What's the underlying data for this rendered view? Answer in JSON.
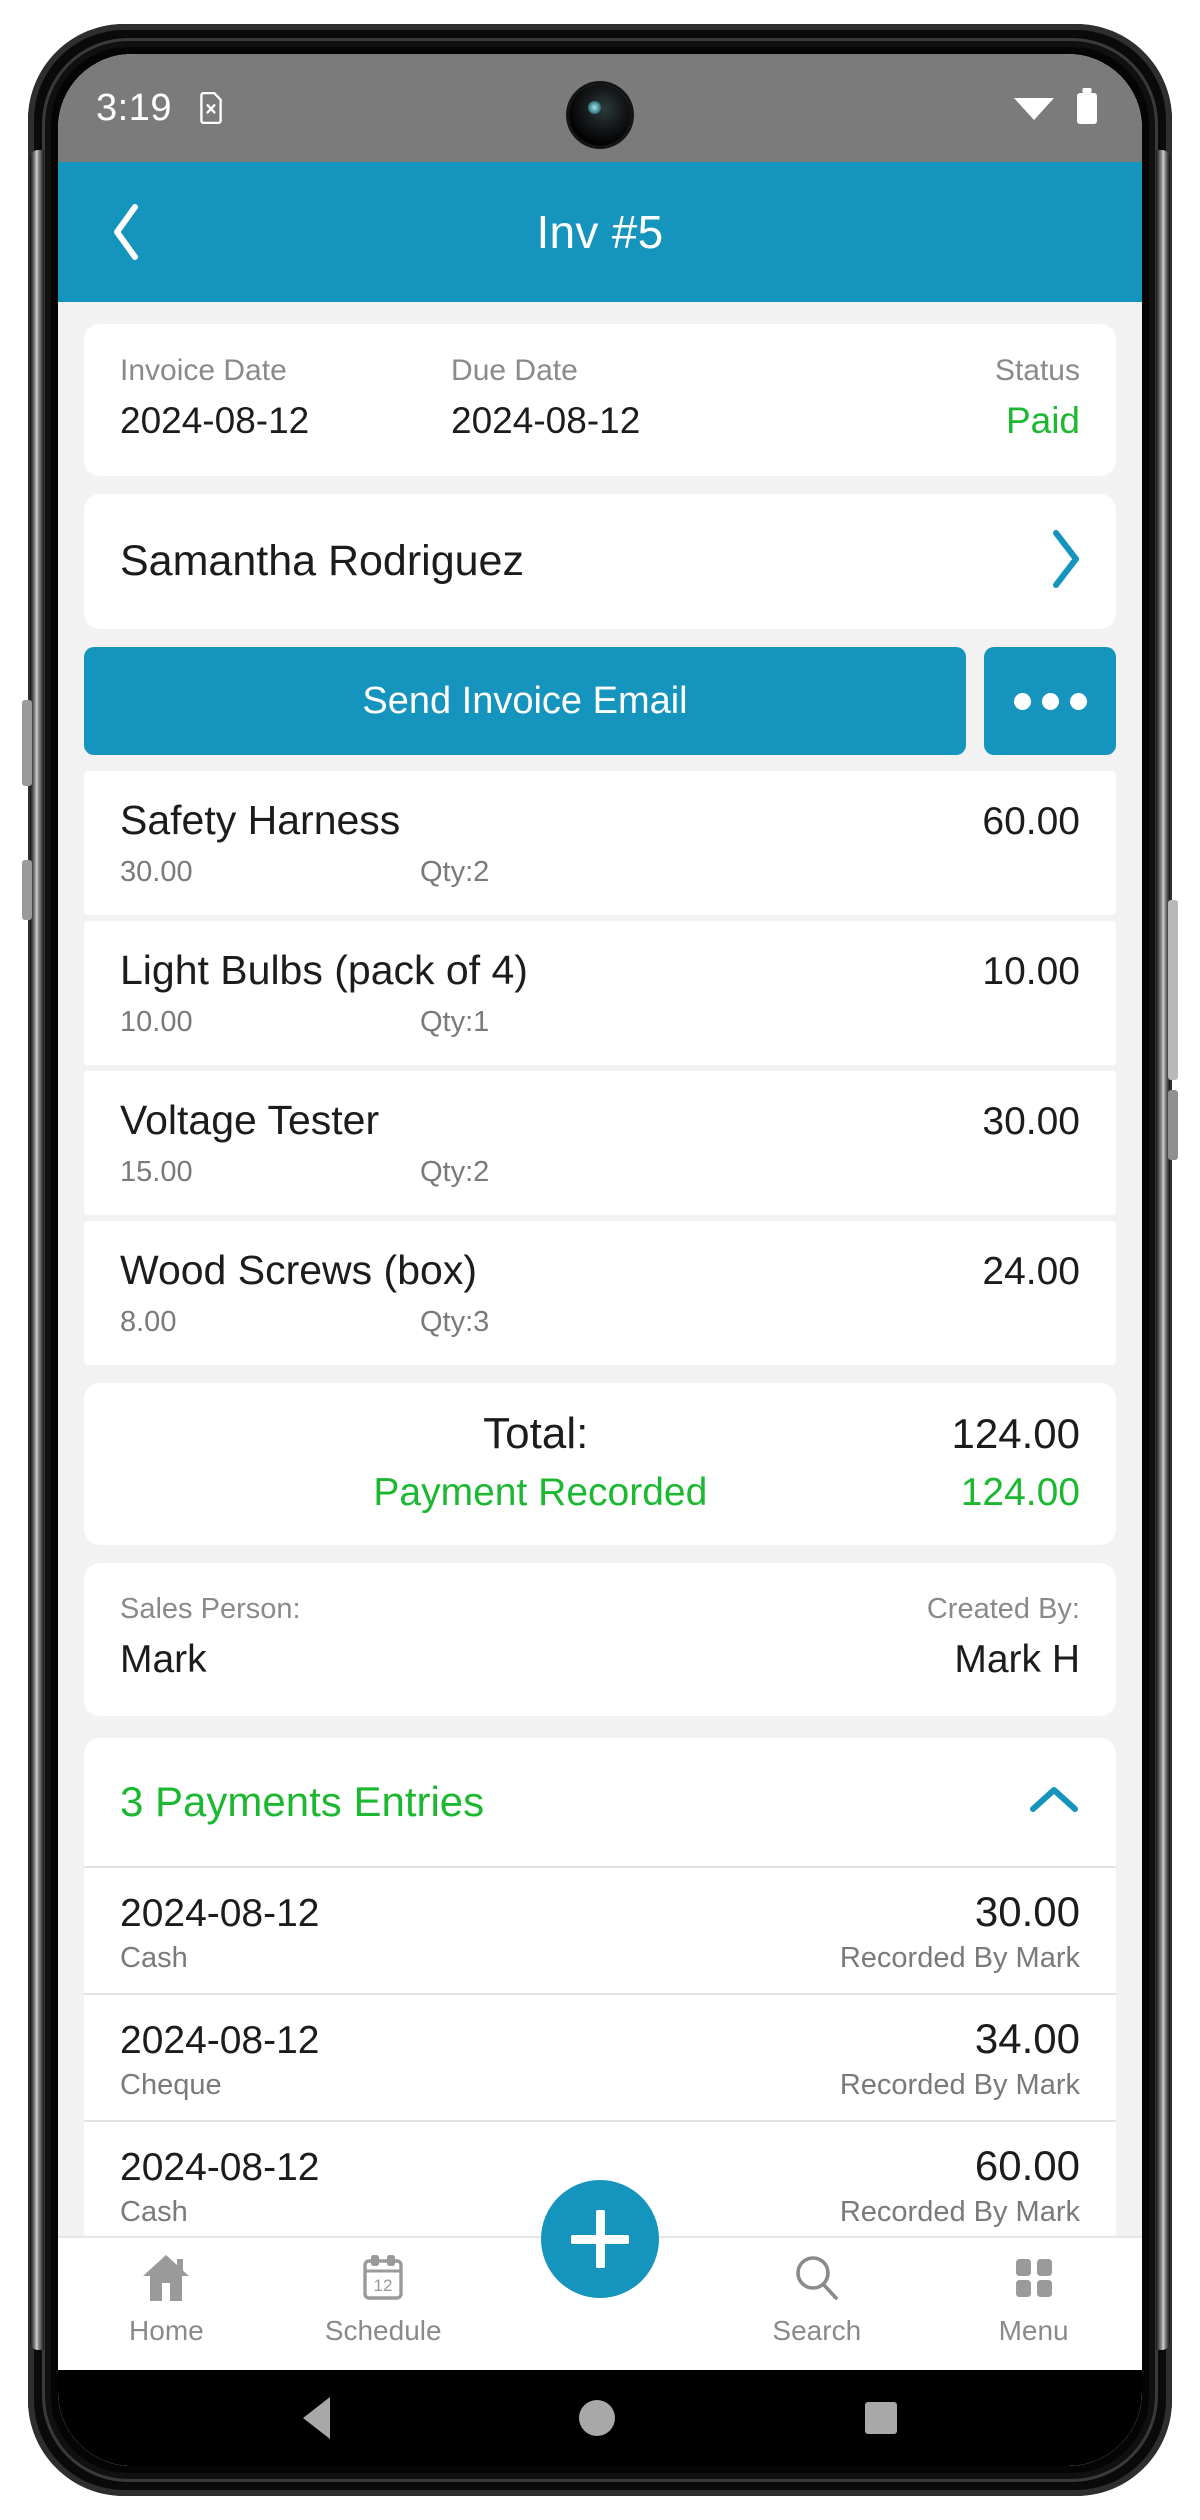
{
  "colors": {
    "accent": "#1594be",
    "success": "#1db832",
    "statusbar": "#7b7b7b",
    "page_bg": "#f2f2f2",
    "card_bg": "#ffffff",
    "muted_text": "#8a8a8a",
    "primary_text": "#1c1c1c"
  },
  "statusbar": {
    "time": "3:19",
    "sim_icon": "sim-card-off-icon",
    "wifi_icon": "wifi-icon",
    "battery_icon": "battery-icon"
  },
  "appbar": {
    "back_icon": "chevron-left-icon",
    "title": "Inv #5"
  },
  "dates": {
    "invoice_date_label": "Invoice Date",
    "invoice_date_value": "2024-08-12",
    "due_date_label": "Due Date",
    "due_date_value": "2024-08-12",
    "status_label": "Status",
    "status_value": "Paid"
  },
  "customer": {
    "name": "Samantha Rodriguez",
    "chevron_icon": "chevron-right-icon"
  },
  "actions": {
    "send_email_label": "Send Invoice Email",
    "more_icon": "ellipsis-icon"
  },
  "line_items": [
    {
      "name": "Safety Harness",
      "amount": "60.00",
      "unit_price": "30.00",
      "qty": "Qty:2"
    },
    {
      "name": "Light Bulbs (pack of 4)",
      "amount": "10.00",
      "unit_price": "10.00",
      "qty": "Qty:1"
    },
    {
      "name": "Voltage Tester",
      "amount": "30.00",
      "unit_price": "15.00",
      "qty": "Qty:2"
    },
    {
      "name": "Wood Screws (box)",
      "amount": "24.00",
      "unit_price": "8.00",
      "qty": "Qty:3"
    }
  ],
  "totals": {
    "total_label": "Total:",
    "total_value": "124.00",
    "payment_recorded_label": "Payment Recorded",
    "payment_recorded_value": "124.00"
  },
  "people": {
    "sales_person_label": "Sales Person:",
    "sales_person_value": "Mark",
    "created_by_label": "Created By:",
    "created_by_value": "Mark H"
  },
  "payments": {
    "section_title": "3 Payments Entries",
    "collapse_icon": "chevron-up-icon",
    "entries": [
      {
        "date": "2024-08-12",
        "amount": "30.00",
        "method": "Cash",
        "recorded_by": "Recorded By Mark"
      },
      {
        "date": "2024-08-12",
        "amount": "34.00",
        "method": "Cheque",
        "recorded_by": "Recorded By Mark"
      },
      {
        "date": "2024-08-12",
        "amount": "60.00",
        "method": "Cash",
        "recorded_by": "Recorded By Mark"
      }
    ]
  },
  "bottom_nav": {
    "items": [
      {
        "label": "Home",
        "icon": "home-icon"
      },
      {
        "label": "Schedule",
        "icon": "calendar-icon",
        "badge": "12"
      },
      {
        "label": "Search",
        "icon": "search-icon"
      },
      {
        "label": "Menu",
        "icon": "grid-menu-icon"
      }
    ],
    "fab_icon": "plus-icon"
  },
  "system_nav": {
    "back_icon": "triangle-back-icon",
    "home_icon": "circle-home-icon",
    "recents_icon": "square-recents-icon"
  }
}
